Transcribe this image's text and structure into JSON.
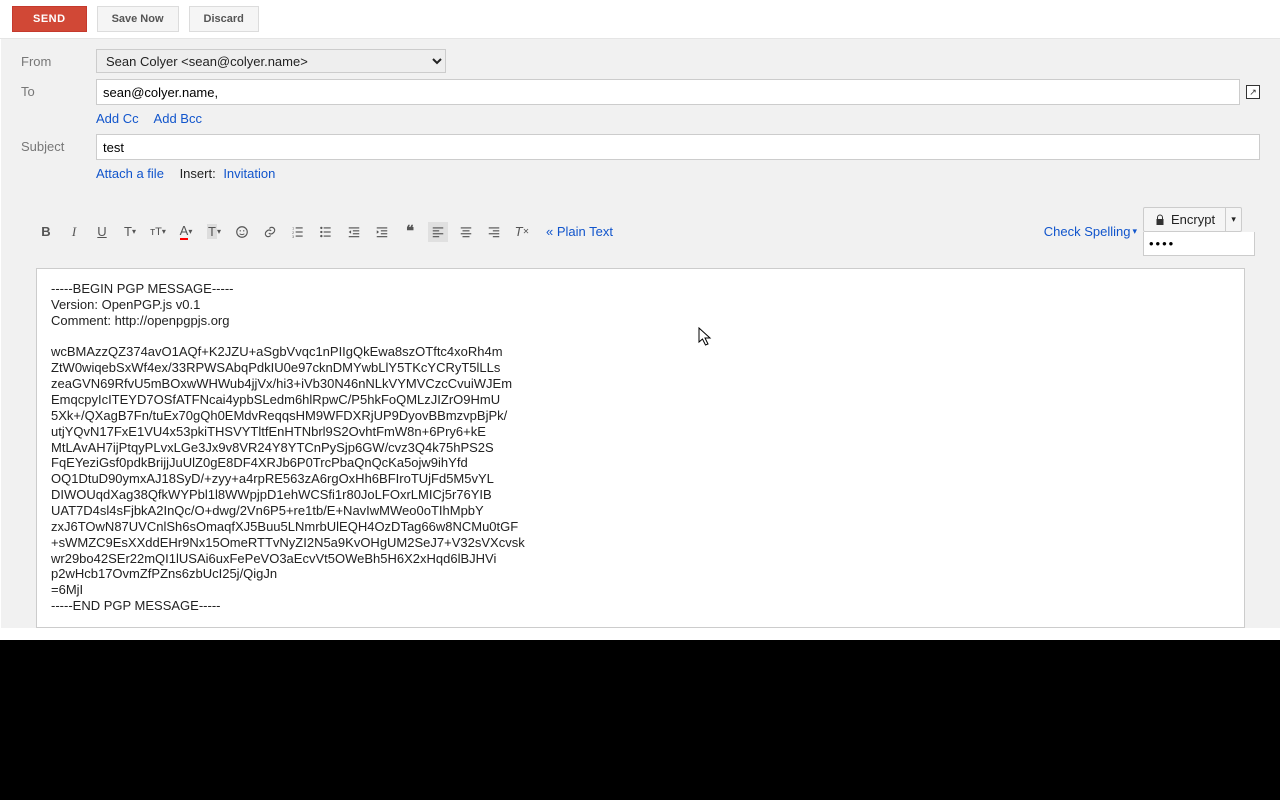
{
  "topbar": {
    "send": "SEND",
    "save_now": "Save Now",
    "discard": "Discard"
  },
  "form": {
    "from_label": "From",
    "from_value": "Sean Colyer <sean@colyer.name>",
    "to_label": "To",
    "to_value": "sean@colyer.name,",
    "add_cc": "Add Cc",
    "add_bcc": "Add Bcc",
    "subject_label": "Subject",
    "subject_value": "test",
    "attach_file": "Attach a file",
    "insert_label": "Insert:",
    "invitation": "Invitation"
  },
  "toolbar": {
    "plain_text": "« Plain Text",
    "check_spelling": "Check Spelling",
    "encrypt": "Encrypt",
    "encrypt_pass": "••••"
  },
  "body_text": "-----BEGIN PGP MESSAGE-----\nVersion: OpenPGP.js v0.1\nComment: http://openpgpjs.org\n\nwcBMAzzQZ374avO1AQf+K2JZU+aSgbVvqc1nPIIgQkEwa8szOTftc4xoRh4m\nZtW0wiqebSxWf4ex/33RPWSAbqPdkIU0e97cknDMYwbLlY5TKcYCRyT5lLLs\nzeaGVN69RfvU5mBOxwWHWub4jjVx/hi3+iVb30N46nNLkVYMVCzcCvuiWJEm\nEmqcpyIcITEYD7OSfATFNcai4ypbSLedm6hlRpwC/P5hkFoQMLzJIZrO9HmU\n5Xk+/QXagB7Fn/tuEx70gQh0EMdvReqqsHM9WFDXRjUP9DyovBBmzvpBjPk/\nutjYQvN17FxE1VU4x53pkiTHSVYTltfEnHTNbrl9S2OvhtFmW8n+6Pry6+kE\nMtLAvAH7ijPtqyPLvxLGe3Jx9v8VR24Y8YTCnPySjp6GW/cvz3Q4k75hPS2S\nFqEYeziGsf0pdkBrijjJuUlZ0gE8DF4XRJb6P0TrcPbaQnQcKa5ojw9ihYfd\nOQ1DtuD90ymxAJ18SyD/+zyy+a4rpRE563zA6rgOxHh6BFIroTUjFd5M5vYL\nDIWOUqdXag38QfkWYPbl1l8WWpjpD1ehWCSfi1r80JoLFOxrLMICj5r76YIB\nUAT7D4sl4sFjbkA2InQc/O+dwg/2Vn6P5+re1tb/E+NavIwMWeo0oTIhMpbY\nzxJ6TOwN87UVCnlSh6sOmaqfXJ5Buu5LNmrbUlEQH4OzDTag66w8NCMu0tGF\n+sWMZC9EsXXddEHr9Nx15OmeRTTvNyZI2N5a9KvOHgUM2SeJ7+V32sVXcvsk\nwr29bo42SEr22mQI1lUSAi6uxFePeVO3aEcvVt5OWeBh5H6X2xHqd6lBJHVi\np2wHcb17OvmZfPZns6zbUcI25j/QigJn\n=6MjI\n-----END PGP MESSAGE-----"
}
